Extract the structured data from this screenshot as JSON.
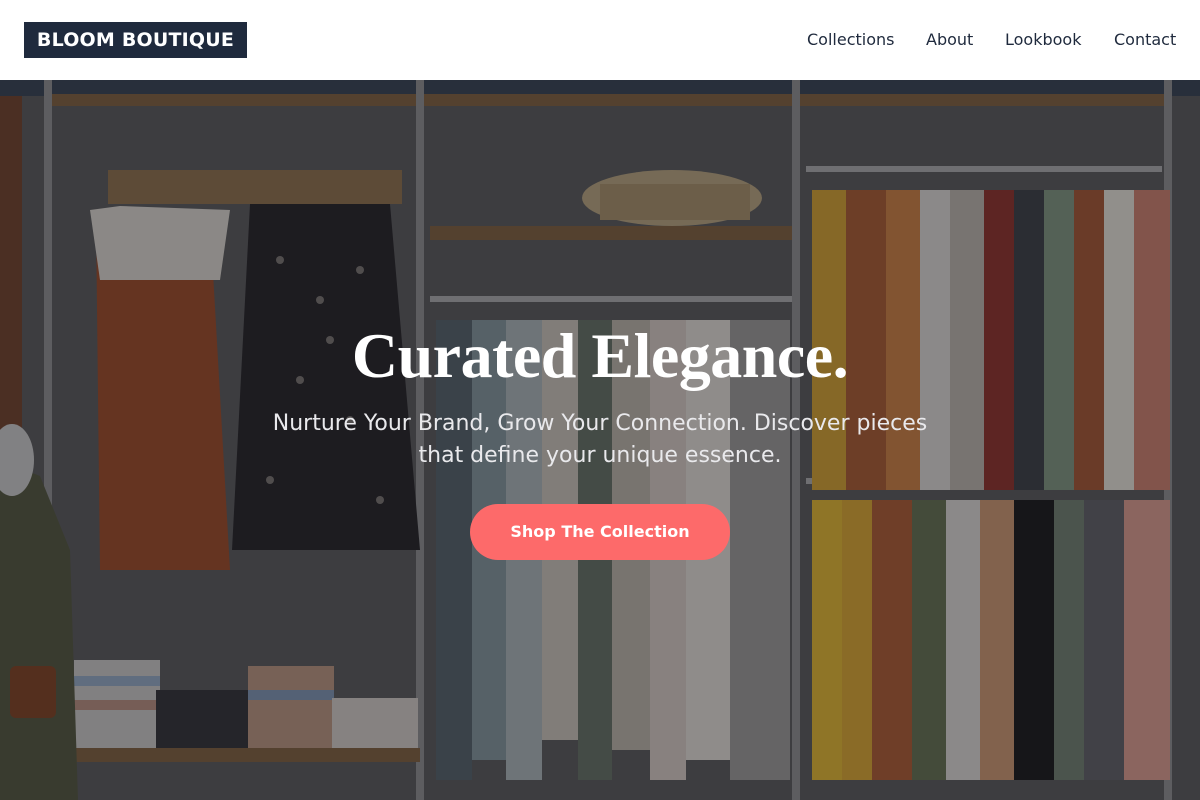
{
  "header": {
    "logo": "BLOOM BOUTIQUE",
    "nav": [
      "Collections",
      "About",
      "Lookbook",
      "Contact"
    ]
  },
  "hero": {
    "title": "Curated Elegance.",
    "subtitle": "Nurture Your Brand, Grow Your Connection. Discover pieces that define your unique essence.",
    "cta_label": "Shop The Collection"
  },
  "colors": {
    "header_bg": "#ffffff",
    "logo_bg": "#1f2a3d",
    "nav_text": "#1f2a3d",
    "cta_bg": "#fd6a6a",
    "hero_text": "#ffffff"
  }
}
